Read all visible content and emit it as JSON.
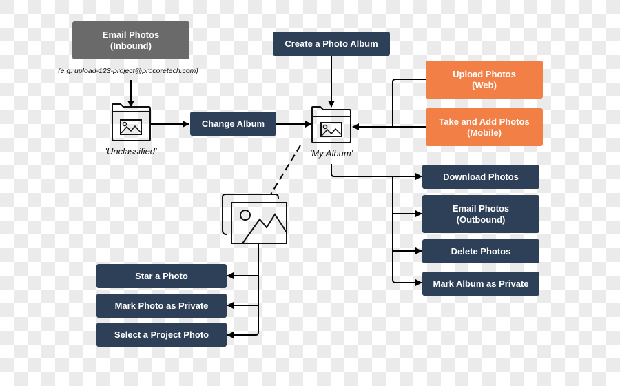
{
  "diagram": {
    "colors": {
      "action": "#2e3f58",
      "upload": "#f27f45",
      "inbound": "#6a6a6a",
      "line": "#000000",
      "checker_light": "#ffffff",
      "checker_dark": "#ebebeb"
    },
    "nodes": {
      "email_inbound": {
        "line1": "Email Photos",
        "line2": "(Inbound)"
      },
      "email_example": "(e.g. upload-123-project@procoretech.com)",
      "unclassified_folder": {
        "icon": "photo-folder-icon",
        "label": "'Unclassified'"
      },
      "change_album": {
        "label": "Change Album"
      },
      "create_album": {
        "label": "Create a Photo Album"
      },
      "my_album_folder": {
        "icon": "photo-folder-icon",
        "label": "'My Album'"
      },
      "upload_web": {
        "line1": "Upload Photos",
        "line2": "(Web)"
      },
      "take_add_mobile": {
        "line1": "Take and Add Photos",
        "line2": "(Mobile)"
      },
      "album_actions": [
        {
          "line1": "Download Photos",
          "line2": ""
        },
        {
          "line1": "Email Photos",
          "line2": "(Outbound)"
        },
        {
          "line1": "Delete Photos",
          "line2": ""
        },
        {
          "line1": "Mark Album as Private",
          "line2": ""
        }
      ],
      "single_photo": {
        "icon": "photo-icon"
      },
      "photo_actions": [
        {
          "label": "Star a Photo"
        },
        {
          "label": "Mark Photo as Private"
        },
        {
          "label": "Select a Project Photo"
        }
      ]
    },
    "edges": [
      {
        "from": "email_inbound",
        "to": "unclassified_folder",
        "style": "solid-arrow"
      },
      {
        "from": "unclassified_folder",
        "to": "change_album",
        "style": "solid-arrow"
      },
      {
        "from": "change_album",
        "to": "my_album_folder",
        "style": "solid-arrow"
      },
      {
        "from": "create_album",
        "to": "my_album_folder",
        "style": "solid-arrow"
      },
      {
        "from": "upload_web",
        "to": "my_album_folder",
        "style": "solid-arrow"
      },
      {
        "from": "take_add_mobile",
        "to": "my_album_folder",
        "style": "solid-arrow"
      },
      {
        "from": "my_album_folder",
        "to": "album_actions",
        "style": "solid-arrow"
      },
      {
        "from": "my_album_folder",
        "to": "single_photo",
        "style": "dashed"
      },
      {
        "from": "single_photo",
        "to": "photo_actions",
        "style": "solid-arrow"
      }
    ]
  }
}
